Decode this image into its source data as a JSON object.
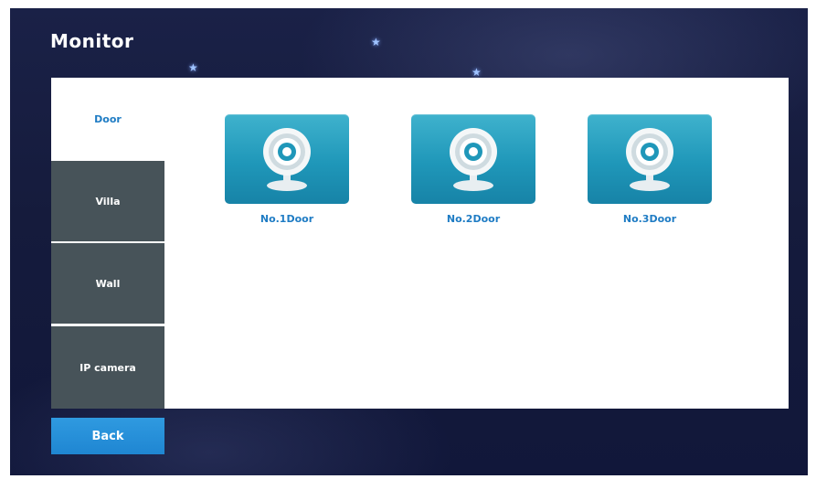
{
  "header": {
    "title": "Monitor"
  },
  "sidebar": {
    "tabs": [
      {
        "label": "Door",
        "active": true
      },
      {
        "label": "Villa",
        "active": false
      },
      {
        "label": "Wall",
        "active": false
      },
      {
        "label": "IP camera",
        "active": false
      }
    ]
  },
  "devices": [
    {
      "label": "No.1Door",
      "icon": "webcam-icon"
    },
    {
      "label": "No.2Door",
      "icon": "webcam-icon"
    },
    {
      "label": "No.3Door",
      "icon": "webcam-icon"
    }
  ],
  "footer": {
    "back_label": "Back"
  },
  "colors": {
    "accent": "#1f7cc4",
    "tile": "#1f97b9",
    "tab_inactive": "#475359",
    "background": "#151b3c"
  }
}
